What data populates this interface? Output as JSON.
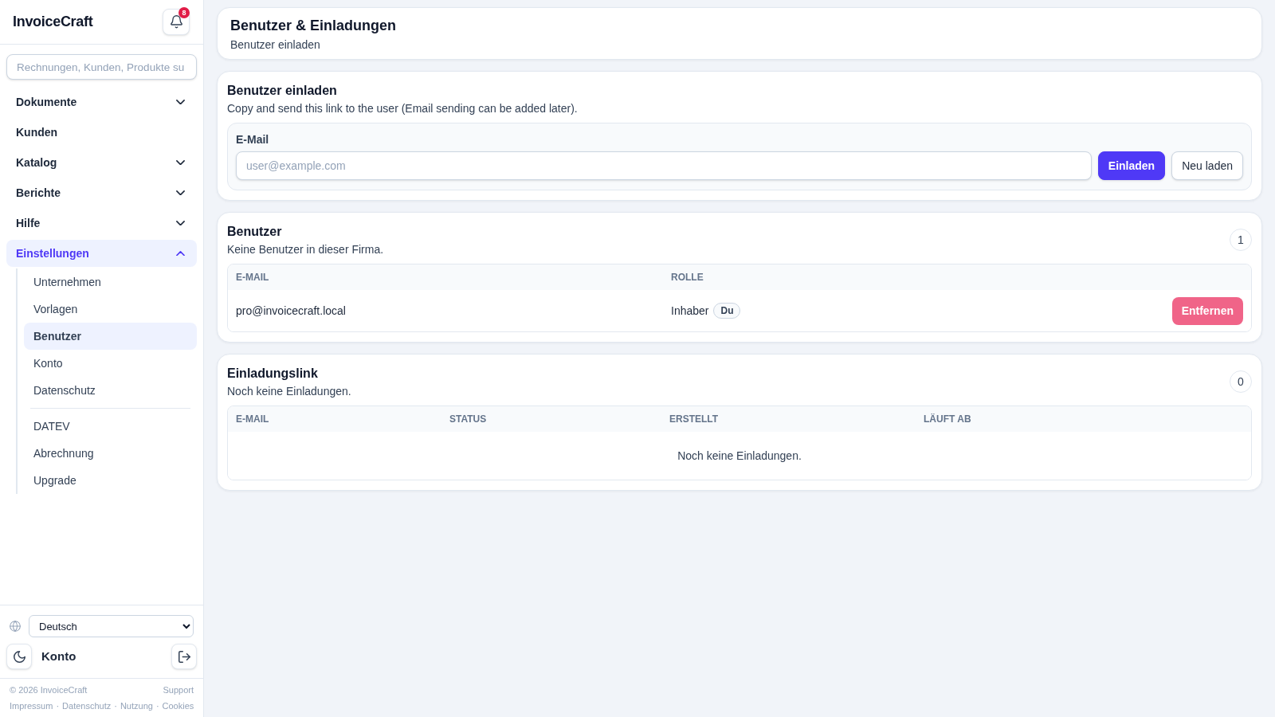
{
  "sidebar": {
    "brand": "InvoiceCraft",
    "notifications": {
      "count": "8"
    },
    "search": {
      "placeholder": "Rechnungen, Kunden, Produkte su"
    },
    "nav": [
      {
        "label": "Dokumente",
        "kind": "group",
        "expanded": false,
        "selected": false
      },
      {
        "label": "Kunden",
        "kind": "link",
        "selected": false
      },
      {
        "label": "Katalog",
        "kind": "group",
        "expanded": false,
        "selected": false
      },
      {
        "label": "Berichte",
        "kind": "group",
        "expanded": false,
        "selected": false
      },
      {
        "label": "Hilfe",
        "kind": "group",
        "expanded": false,
        "selected": false
      },
      {
        "label": "Einstellungen",
        "kind": "group",
        "expanded": true,
        "selected": true,
        "children": [
          {
            "label": "Unternehmen",
            "selected": false,
            "divider_before": false
          },
          {
            "label": "Vorlagen",
            "selected": false,
            "divider_before": false
          },
          {
            "label": "Benutzer",
            "selected": true,
            "divider_before": false
          },
          {
            "label": "Konto",
            "selected": false,
            "divider_before": false
          },
          {
            "label": "Datenschutz",
            "selected": false,
            "divider_before": false
          },
          {
            "label": "DATEV",
            "selected": false,
            "divider_before": true
          },
          {
            "label": "Abrechnung",
            "selected": false,
            "divider_before": false
          },
          {
            "label": "Upgrade",
            "selected": false,
            "divider_before": false
          }
        ]
      }
    ],
    "language": {
      "value": "Deutsch"
    },
    "account": {
      "label": "Konto"
    },
    "footer": {
      "copyright": "© 2026 InvoiceCraft",
      "support": "Support",
      "links": [
        "Impressum",
        "Datenschutz",
        "Nutzung",
        "Cookies"
      ],
      "separators": [
        "·",
        "·",
        "·"
      ]
    }
  },
  "page_header": {
    "title": "Benutzer & Einladungen",
    "subtitle": "Benutzer einladen"
  },
  "invite": {
    "title": "Benutzer einladen",
    "description": "Copy and send this link to the user (Email sending can be added later).",
    "email_label": "E-Mail",
    "email": {
      "placeholder": "user@example.com"
    },
    "buttons": [
      {
        "label": "Einladen",
        "kind": "primary"
      },
      {
        "label": "Neu laden",
        "kind": "secondary"
      }
    ]
  },
  "users": {
    "title": "Benutzer",
    "description": "Keine Benutzer in dieser Firma.",
    "count": "1",
    "table": {
      "columns": [
        "E-MAIL",
        "ROLLE"
      ],
      "rows": [
        {
          "email": "pro@invoicecraft.local",
          "role": "Inhaber",
          "tag": "Du",
          "action": "Entfernen"
        }
      ]
    }
  },
  "invitations": {
    "title": "Einladungslink",
    "description": "Noch keine Einladungen.",
    "count": "0",
    "table": {
      "columns": [
        "E-MAIL",
        "STATUS",
        "ERSTELLT",
        "LÄUFT AB"
      ],
      "empty_message": "Noch keine Einladungen."
    }
  }
}
